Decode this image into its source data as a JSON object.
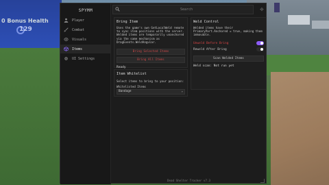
{
  "hud": {
    "health_text": "0 Bonus Health",
    "badge_value": "129"
  },
  "app": {
    "brand": "SPYMM",
    "footer": "Dead Shelter Tracker v7.3"
  },
  "search": {
    "placeholder": "Search"
  },
  "nav": {
    "items": [
      {
        "label": "Player",
        "icon": "person-icon"
      },
      {
        "label": "Combat",
        "icon": "sword-icon"
      },
      {
        "label": "Visuals",
        "icon": "eye-icon"
      },
      {
        "label": "Items",
        "icon": "box-icon"
      },
      {
        "label": "UI Settings",
        "icon": "gear-icon"
      }
    ],
    "active_index": 3,
    "accent_color": "#8d6bff"
  },
  "bring_item": {
    "title": "Bring Item",
    "description": "Uses the game's own GetLocalWeld remote to sync item positions with the server. Welded items are temporarily unanchored via the same mechanism as DragEvents.WeldAngular.",
    "button_selected": "Bring Selected Items",
    "button_all": "Bring All Items",
    "status": "Ready"
  },
  "whitelist": {
    "title": "Item Whitelist",
    "description": "Select items to bring to your position:",
    "label": "Whitelisted Items",
    "selected_value": "Bandage"
  },
  "weld_control": {
    "title": "Weld Control",
    "description": "Welded items have their PrimaryPart.Anchored = true, making them immovable.",
    "unweld_label": "Unweld Before Bring",
    "unweld_on": true,
    "reweld_label": "Reweld After Bring",
    "reweld_on": false,
    "scan_button": "Scan Welded Items",
    "scan_status": "Weld scan: Not run yet",
    "highlight_color": "#d64545"
  }
}
